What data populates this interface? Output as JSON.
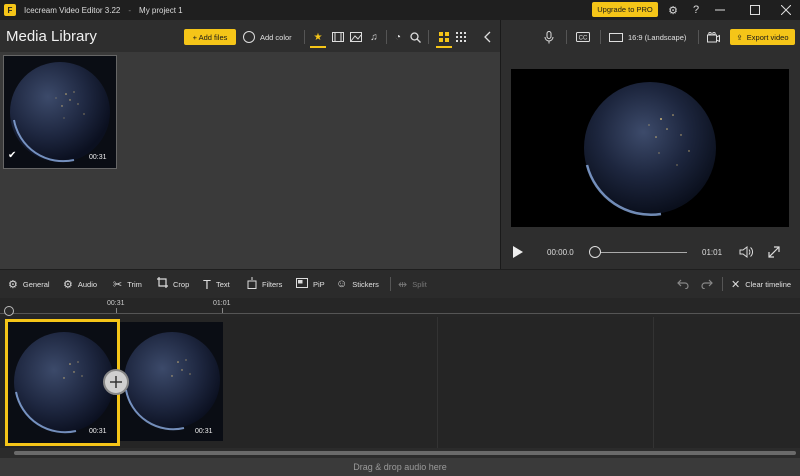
{
  "window": {
    "app_name": "Icecream Video Editor 3.22",
    "separator": "-",
    "project_name": "My project 1",
    "upgrade_label": "Upgrade to PRO",
    "logo_letter": "F"
  },
  "media_library": {
    "title": "Media Library",
    "add_files_label": "+ Add files",
    "add_color_label": "Add color",
    "items": [
      {
        "duration": "00:31",
        "selected": true
      }
    ]
  },
  "preview": {
    "aspect_label": "16:9 (Landscape)",
    "export_label": "Export video",
    "current_time": "00:00.0",
    "end_time": "01:01",
    "progress": 0
  },
  "toolbar": {
    "tools": [
      {
        "label": "General",
        "icon": "gear-icon"
      },
      {
        "label": "Audio",
        "icon": "audio-gear-icon"
      },
      {
        "label": "Trim",
        "icon": "scissors-icon"
      },
      {
        "label": "Crop",
        "icon": "crop-icon"
      },
      {
        "label": "Text",
        "icon": "text-icon"
      },
      {
        "label": "Filters",
        "icon": "filters-icon"
      },
      {
        "label": "PiP",
        "icon": "pip-icon"
      },
      {
        "label": "Stickers",
        "icon": "sticker-icon"
      },
      {
        "label": "Split",
        "icon": "split-icon",
        "disabled": true
      }
    ],
    "clear_timeline_label": "Clear timeline"
  },
  "timeline": {
    "ticks": [
      "00:31",
      "01:01"
    ],
    "clips": [
      {
        "duration": "00:31",
        "selected": true
      },
      {
        "duration": "00:31",
        "selected": false
      }
    ],
    "audio_drop_label": "Drag & drop audio here"
  },
  "colors": {
    "accent": "#f5c518",
    "background": "#2b2b2b",
    "panel": "#3a3a3a"
  }
}
